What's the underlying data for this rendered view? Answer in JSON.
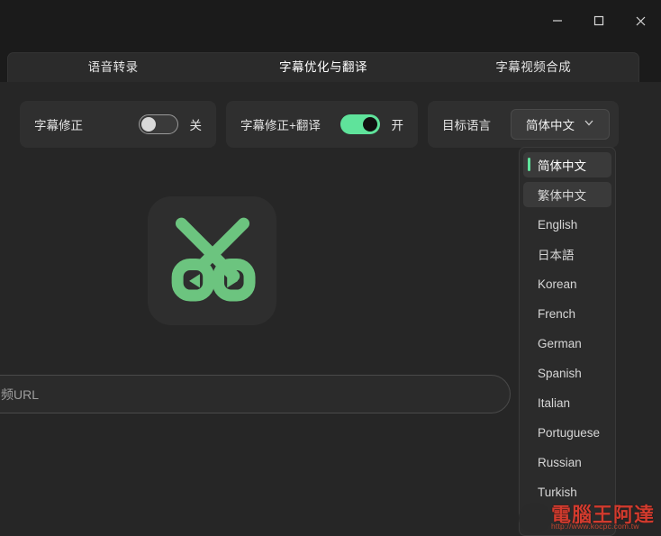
{
  "window": {
    "controls": [
      {
        "name": "minimize",
        "glyph": "minimize-icon"
      },
      {
        "name": "maximize",
        "glyph": "maximize-icon"
      },
      {
        "name": "close",
        "glyph": "close-icon"
      }
    ]
  },
  "tabs": [
    {
      "label": "语音转录",
      "active": false
    },
    {
      "label": "字幕优化与翻译",
      "active": true
    },
    {
      "label": "字幕视频合成",
      "active": false
    }
  ],
  "options": {
    "subtitle_fix": {
      "label": "字幕修正",
      "state_label": "关",
      "enabled": false
    },
    "subtitle_fix_translate": {
      "label": "字幕修正+翻译",
      "state_label": "开",
      "enabled": true
    },
    "target_language": {
      "label": "目标语言",
      "selected": "简体中文"
    }
  },
  "language_dropdown": {
    "items": [
      {
        "label": "简体中文",
        "selected": true,
        "highlighted": true
      },
      {
        "label": "繁体中文",
        "selected": false,
        "highlighted": true
      },
      {
        "label": "English",
        "selected": false,
        "highlighted": false
      },
      {
        "label": "日本語",
        "selected": false,
        "highlighted": false
      },
      {
        "label": "Korean",
        "selected": false,
        "highlighted": false
      },
      {
        "label": "French",
        "selected": false,
        "highlighted": false
      },
      {
        "label": "German",
        "selected": false,
        "highlighted": false
      },
      {
        "label": "Spanish",
        "selected": false,
        "highlighted": false
      },
      {
        "label": "Italian",
        "selected": false,
        "highlighted": false
      },
      {
        "label": "Portuguese",
        "selected": false,
        "highlighted": false
      },
      {
        "label": "Russian",
        "selected": false,
        "highlighted": false
      },
      {
        "label": "Turkish",
        "selected": false,
        "highlighted": false
      }
    ]
  },
  "logo": {
    "name": "scissors-logo",
    "color": "#6cc47f"
  },
  "url_field": {
    "placeholder": "频URL",
    "value": ""
  },
  "watermark": {
    "title": "電腦王阿達",
    "url": "http://www.kocpc.com.tw"
  },
  "colors": {
    "background": "#262626",
    "titlebar": "#1b1b1b",
    "card": "#2f2f2f",
    "accent_green": "#5fe39b",
    "logo_green": "#6cc47f",
    "text_primary": "#e8e8e8",
    "text_muted": "#9e9e9e"
  }
}
